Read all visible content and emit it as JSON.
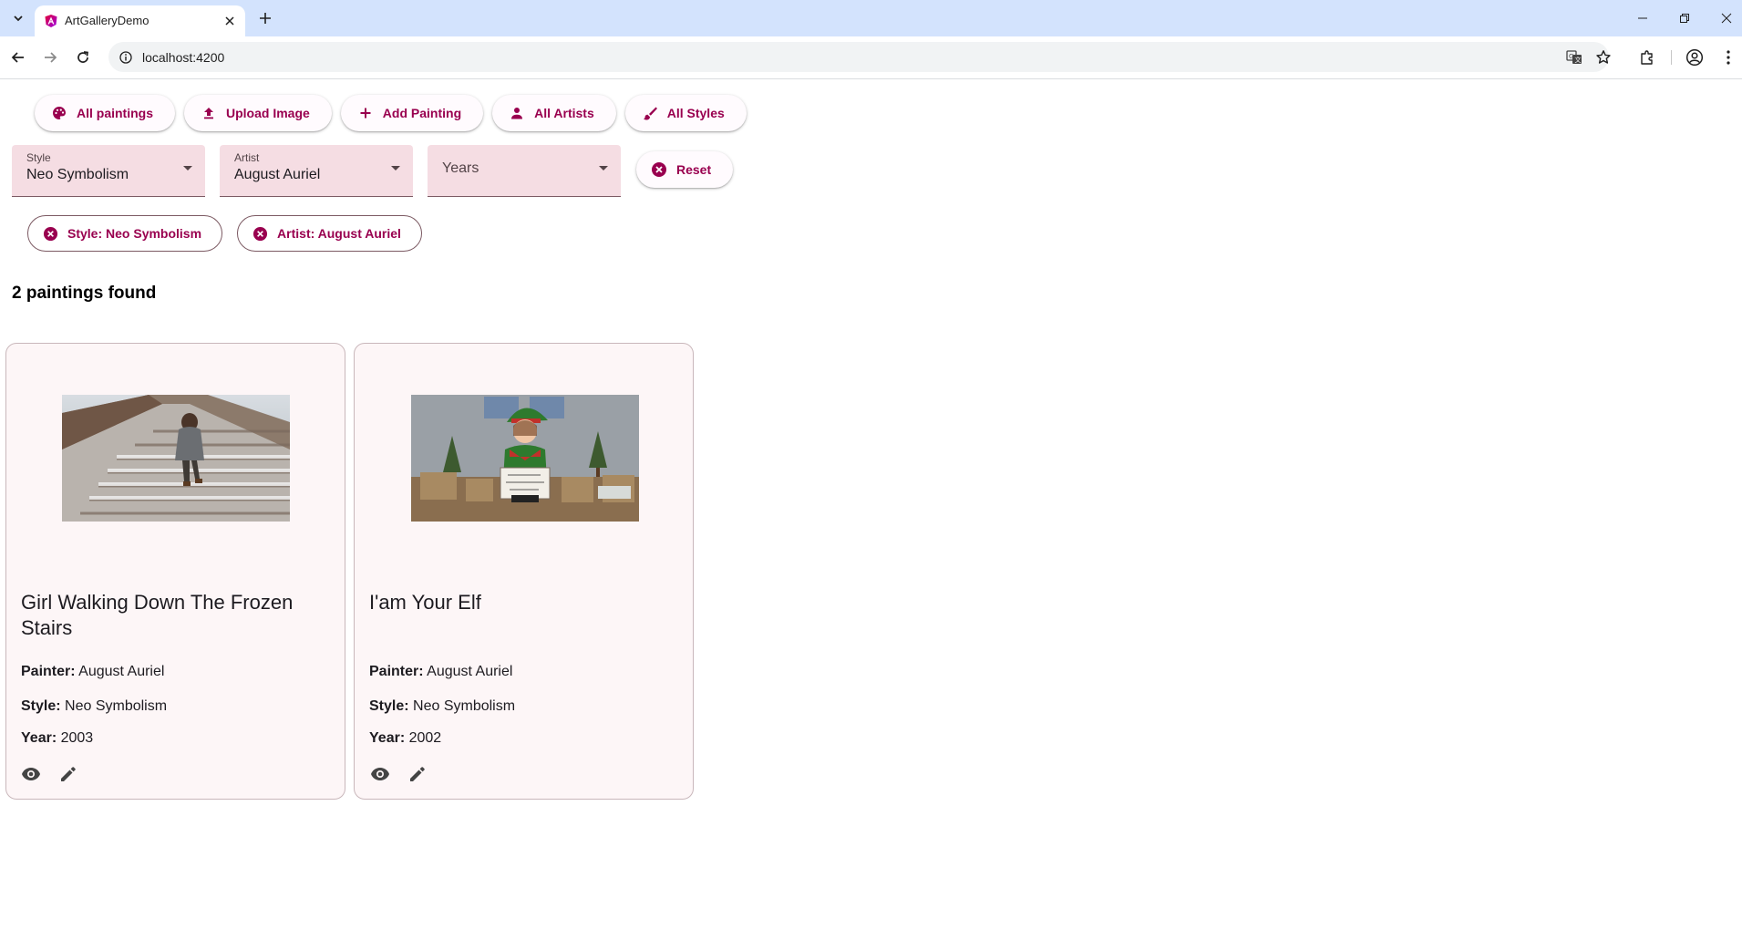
{
  "browser": {
    "tab_title": "ArtGalleryDemo",
    "url": "localhost:4200"
  },
  "nav": {
    "all_paintings": "All paintings",
    "upload_image": "Upload Image",
    "add_painting": "Add Painting",
    "all_artists": "All Artists",
    "all_styles": "All Styles"
  },
  "filters": {
    "style": {
      "label": "Style",
      "value": "Neo Symbolism"
    },
    "artist": {
      "label": "Artist",
      "value": "August Auriel"
    },
    "years": {
      "placeholder": "Years"
    },
    "reset_label": "Reset"
  },
  "chips": [
    {
      "label": "Style: Neo Symbolism"
    },
    {
      "label": "Artist: August Auriel"
    }
  ],
  "results": {
    "count_text": "2 paintings found"
  },
  "labels": {
    "painter": "Painter:",
    "style": "Style:",
    "year": "Year:"
  },
  "paintings": [
    {
      "title": "Girl Walking Down The Frozen Stairs",
      "painter": "August Auriel",
      "style": "Neo Symbolism",
      "year": "2003"
    },
    {
      "title": "I'am Your Elf",
      "painter": "August Auriel",
      "style": "Neo Symbolism",
      "year": "2002"
    }
  ],
  "colors": {
    "accent": "#99004f",
    "field_bg": "#f5dde3",
    "card_bg": "#fdf6f7"
  }
}
